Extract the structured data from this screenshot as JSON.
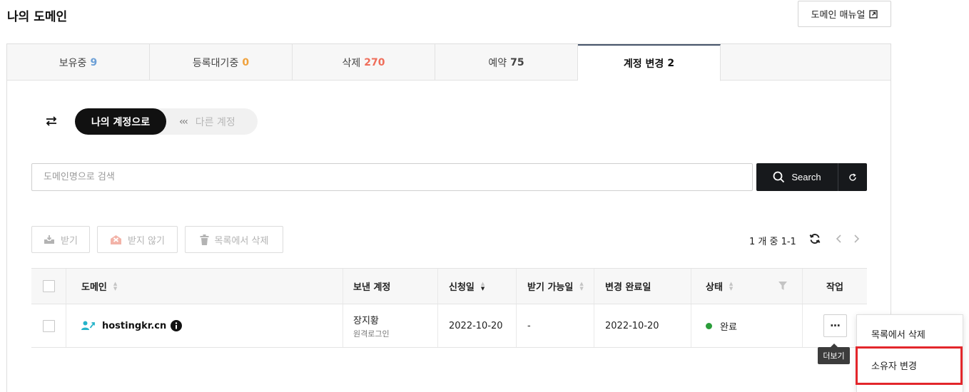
{
  "page": {
    "title": "나의 도메인",
    "manual_button": "도메인 매뉴얼"
  },
  "tabs": [
    {
      "label": "보유중",
      "count": "9",
      "count_color": "#6b9fd6"
    },
    {
      "label": "등록대기중",
      "count": "0",
      "count_color": "#f0a23d"
    },
    {
      "label": "삭제",
      "count": "270",
      "count_color": "#ef6d5a"
    },
    {
      "label": "예약",
      "count": "75",
      "count_color": "#444444"
    },
    {
      "label": "계정 변경",
      "count": "2",
      "count_color": "#111111",
      "active": true
    }
  ],
  "toggle": {
    "active": "나의 계정으로",
    "other": "다른 계정"
  },
  "search": {
    "placeholder": "도메인명으로 검색",
    "value": "",
    "button": "Search"
  },
  "actions": {
    "receive": "받기",
    "decline": "받지 않기",
    "remove": "목록에서 삭제"
  },
  "pager": {
    "text": "1 개 중 1-1"
  },
  "table": {
    "headers": {
      "domain": "도메인",
      "sender": "보낸 계정",
      "request_date": "신청일",
      "receivable_date": "받기 가능일",
      "completed_date": "변경 완료일",
      "status": "상태",
      "action": "작업"
    },
    "rows": [
      {
        "domain": "hostingkr.cn",
        "sender": "장지황",
        "sender_sub": "원격로그인",
        "request_date": "2022-10-20",
        "receivable_date": "-",
        "completed_date": "2022-10-20",
        "status": "완료",
        "status_color": "#2a9d3a"
      }
    ]
  },
  "tooltip": "더보기",
  "menu": {
    "items": [
      "목록에서 삭제",
      "소유자 변경"
    ]
  },
  "colors": {
    "accent_dark": "#17191c",
    "highlight": "#e3262b"
  }
}
